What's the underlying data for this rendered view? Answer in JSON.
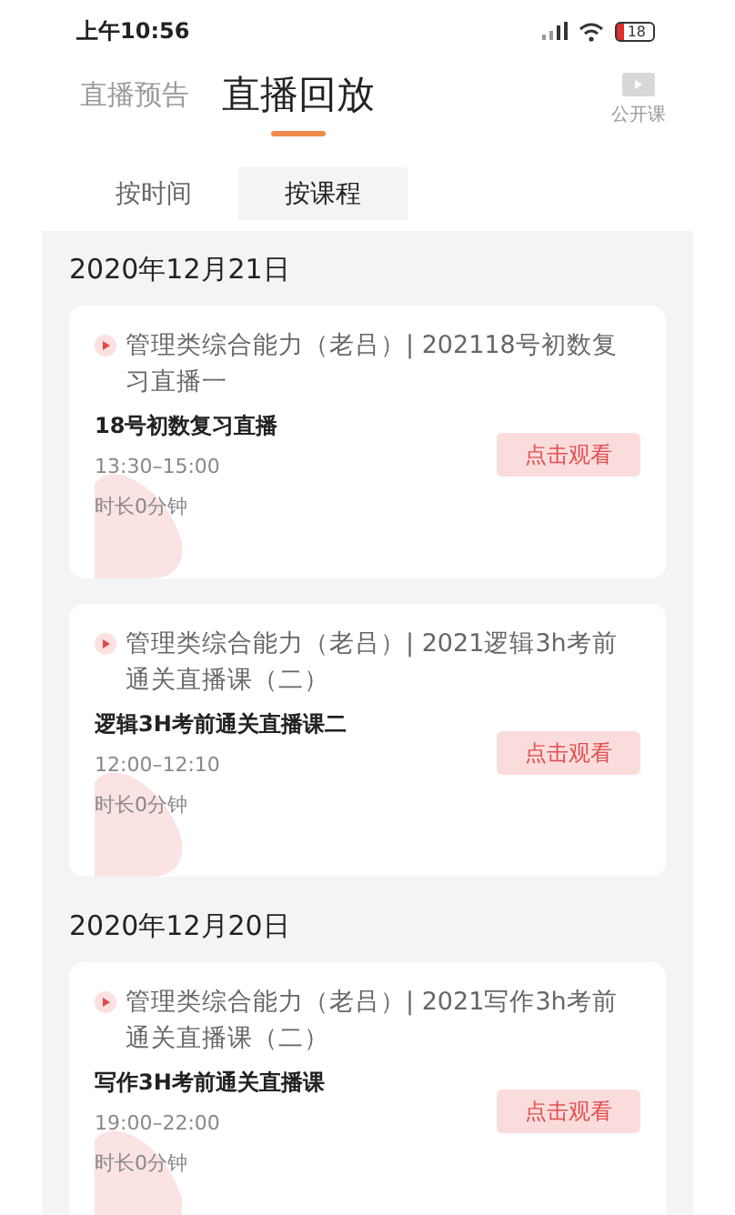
{
  "status_bar": {
    "time": "上午10:56",
    "battery": "18"
  },
  "header_tabs": [
    {
      "label": "直播预告",
      "selected": false
    },
    {
      "label": "直播回放",
      "selected": true
    }
  ],
  "header_action": {
    "label": "公开课"
  },
  "filter_tabs": [
    {
      "label": "按时间",
      "selected": false
    },
    {
      "label": "按课程",
      "selected": true
    }
  ],
  "sections": [
    {
      "date": "2020年12月21日",
      "lessons": [
        {
          "course": "管理类综合能力（老吕）| 202118号初数复习直播一",
          "title": "18号初数复习直播",
          "time": "13:30–15:00",
          "duration": "时长0分钟",
          "button": "点击观看"
        },
        {
          "course": "管理类综合能力（老吕）| 2021逻辑3h考前通关直播课（二）",
          "title": "逻辑3H考前通关直播课二",
          "time": "12:00–12:10",
          "duration": "时长0分钟",
          "button": "点击观看"
        }
      ]
    },
    {
      "date": "2020年12月20日",
      "lessons": [
        {
          "course": "管理类综合能力（老吕）| 2021写作3h考前通关直播课（二）",
          "title": "写作3H考前通关直播课",
          "time": "19:00–22:00",
          "duration": "时长0分钟",
          "button": "点击观看"
        }
      ]
    }
  ]
}
